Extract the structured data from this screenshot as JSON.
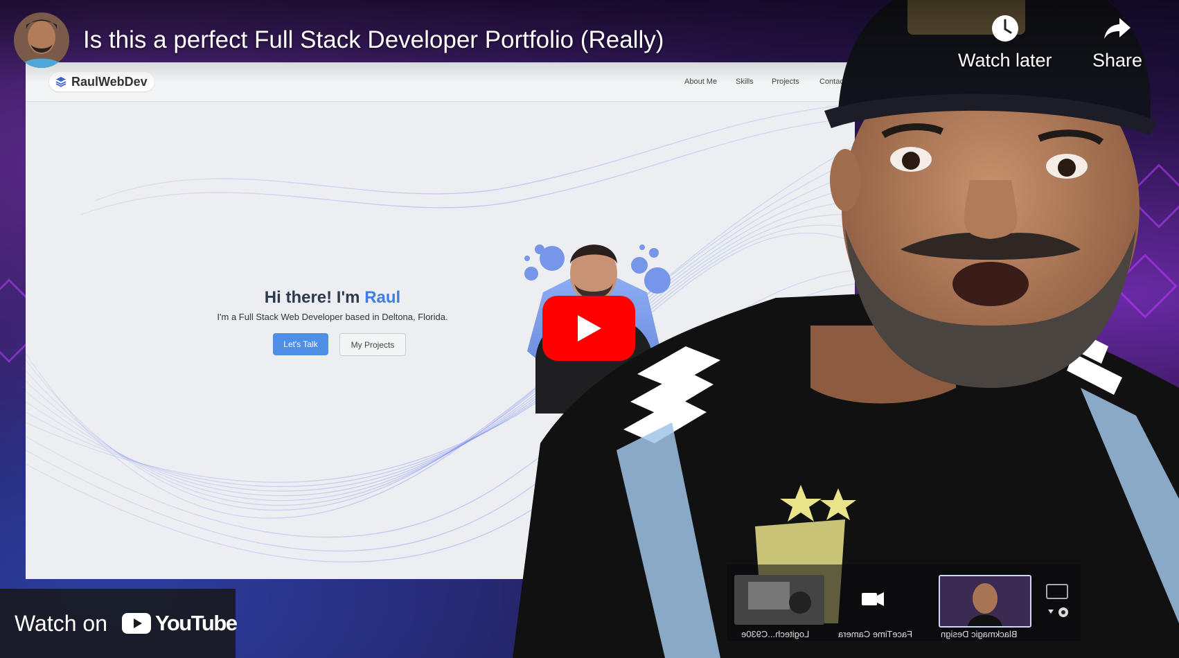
{
  "player": {
    "title": "Is this a perfect Full Stack Developer Portfolio (Really)",
    "actions": {
      "watch_later": "Watch later",
      "share": "Share"
    },
    "watch_on": "Watch on",
    "youtube_logo": "YouTube",
    "play_icon": "play-icon"
  },
  "site": {
    "logo": "RaulWebDev",
    "nav": [
      "About Me",
      "Skills",
      "Projects",
      "Contact M"
    ],
    "hero_title_prefix": "Hi there! I'm ",
    "hero_title_name": "Raul",
    "hero_subtitle": "I'm a Full Stack Web Developer based in Deltona, Florida.",
    "cta_primary": "Let's Talk",
    "cta_secondary": "My Projects"
  },
  "camera_picker": {
    "items": [
      "Logitech...C930e",
      "FaceTime Camera",
      "Blackmagic Design"
    ]
  },
  "colors": {
    "play_red": "#ff0000",
    "site_accent": "#3f7fe0"
  }
}
